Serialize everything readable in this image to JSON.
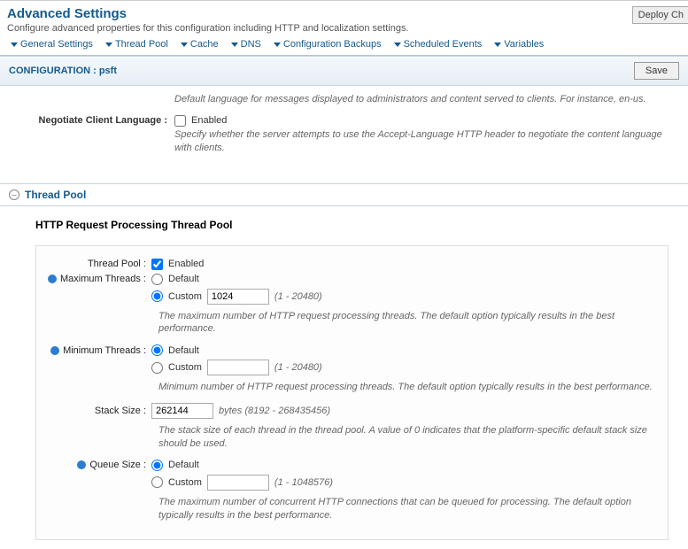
{
  "header": {
    "title": "Advanced Settings",
    "subtitle": "Configure advanced properties for this configuration including HTTP and localization settings.",
    "deploy": "Deploy Ch"
  },
  "tabs": {
    "general": "General Settings",
    "thread": "Thread Pool",
    "cache": "Cache",
    "dns": "DNS",
    "backups": "Configuration Backups",
    "events": "Scheduled Events",
    "vars": "Variables"
  },
  "config": {
    "label": "CONFIGURATION : psft",
    "save": "Save"
  },
  "top": {
    "lang_desc": "Default language for messages displayed to administrators and content served to clients. For instance, en-us.",
    "negotiate_label": "Negotiate Client Language :",
    "enabled": "Enabled",
    "negotiate_desc": "Specify whether the server attempts to use the Accept-Language HTTP header to negotiate the content language with clients."
  },
  "section": {
    "title": "Thread Pool"
  },
  "pool": {
    "title": "HTTP Request Processing Thread Pool",
    "tp_label": "Thread Pool :",
    "enabled": "Enabled",
    "max_label": "Maximum Threads :",
    "default": "Default",
    "custom": "Custom",
    "max_val": "1024",
    "max_range": "(1 - 20480)",
    "max_desc": "The maximum number of HTTP request processing threads. The default option typically results in the best performance.",
    "min_label": "Minimum Threads :",
    "min_range": "(1 - 20480)",
    "min_desc": "Minimum number of HTTP request processing threads. The default option typically results in the best performance.",
    "stack_label": "Stack Size :",
    "stack_val": "262144",
    "stack_range": "bytes (8192 - 268435456)",
    "stack_desc": "The stack size of each thread in the thread pool. A value of 0 indicates that the platform-specific default stack size should be used.",
    "queue_label": "Queue Size :",
    "queue_range": "(1 - 1048576)",
    "queue_desc": "The maximum number of concurrent HTTP connections that can be queued for processing. The default option typically results in the best performance."
  }
}
